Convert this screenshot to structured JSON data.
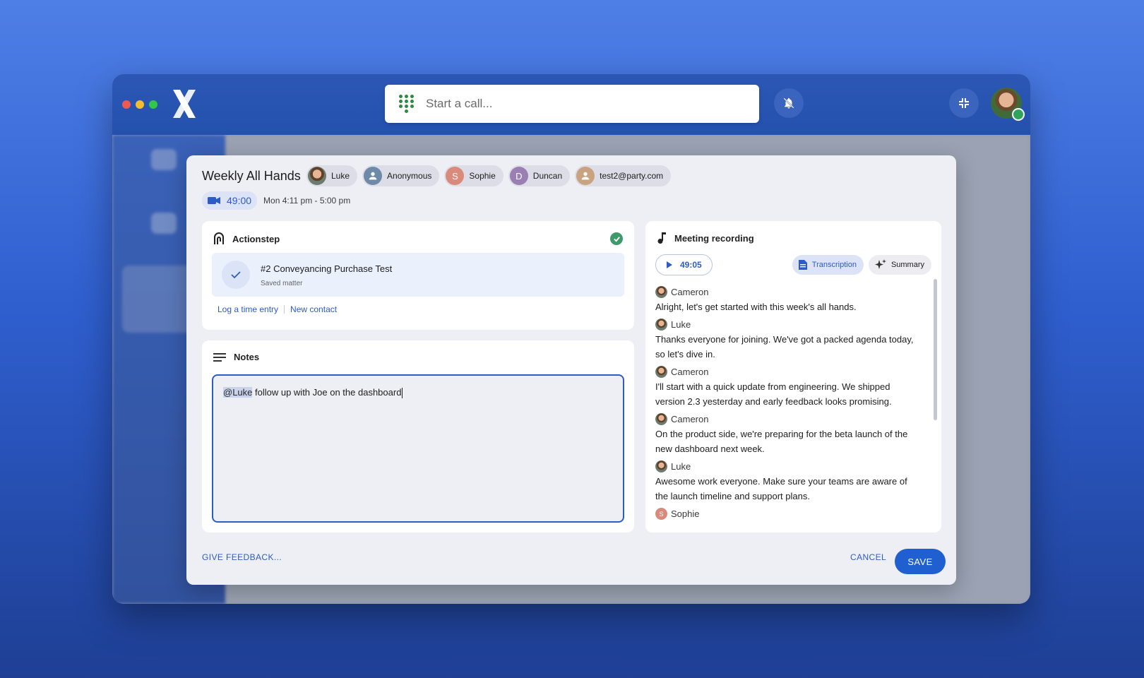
{
  "app": {
    "search_placeholder": "Start a call...",
    "icons": {
      "logo": "x-logo",
      "dialpad": "dialpad-icon",
      "bell": "bell-off-icon",
      "compress": "compress-icon"
    }
  },
  "meeting": {
    "title": "Weekly All Hands",
    "participants": [
      {
        "name": "Luke",
        "avatar": "photo"
      },
      {
        "name": "Anonymous",
        "avatar": "person"
      },
      {
        "name": "Sophie",
        "initial": "S"
      },
      {
        "name": "Duncan",
        "initial": "D"
      },
      {
        "name": "test2@party.com",
        "avatar": "person"
      }
    ],
    "duration": "49:00",
    "time_range": "Mon 4:11 pm - 5:00 pm"
  },
  "actionstep": {
    "title": "Actionstep",
    "matter_title": "#2 Conveyancing Purchase Test",
    "matter_subtitle": "Saved matter",
    "link_time_entry": "Log a time entry",
    "link_new_contact": "New contact"
  },
  "notes": {
    "title": "Notes",
    "mention": "@Luke",
    "text": " follow up with Joe on the dashboard"
  },
  "recording": {
    "title": "Meeting recording",
    "play_time": "49:05",
    "tab_transcription": "Transcription",
    "tab_summary": "Summary",
    "transcript": [
      {
        "speaker": "Cameron",
        "text": "Alright, let's get started with this week's all hands."
      },
      {
        "speaker": "Luke",
        "text": "Thanks everyone for joining. We've got a packed agenda today, so let's dive in."
      },
      {
        "speaker": "Cameron",
        "text": "I'll start with a quick update from engineering. We shipped version 2.3 yesterday and early feedback looks promising."
      },
      {
        "speaker": "Cameron",
        "text": "On the product side, we're preparing for the beta launch of the new dashboard next week."
      },
      {
        "speaker": "Luke",
        "text": "Awesome work everyone. Make sure your teams are aware of the launch timeline and support plans."
      },
      {
        "speaker": "Sophie",
        "text": "",
        "initial": "S"
      }
    ]
  },
  "footer": {
    "feedback_label": "GIVE FEEDBACK...",
    "cancel_label": "CANCEL",
    "save_label": "SAVE"
  },
  "colors": {
    "accent": "#1f5fd0",
    "success": "#3f9a6b"
  }
}
